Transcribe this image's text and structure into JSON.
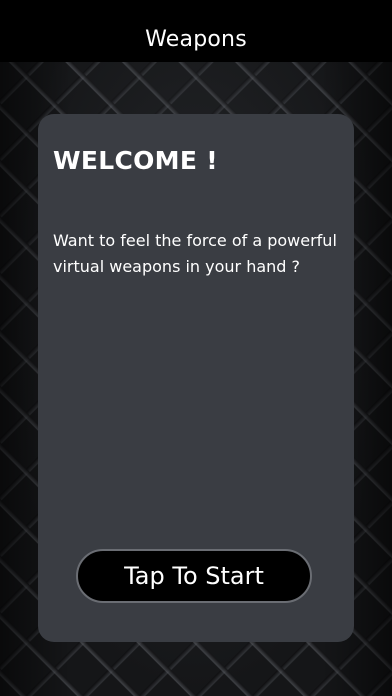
{
  "nav": {
    "title": "Weapons"
  },
  "welcome_card": {
    "title": "WELCOME !",
    "body": "Want to feel the force of a powerful virtual weapons in your hand ?",
    "start_button_label": "Tap To Start"
  },
  "colors": {
    "background": "#000000",
    "card": "#3a3d43",
    "button": "#000000",
    "button_border": "#6a6d73",
    "text": "#ffffff"
  }
}
